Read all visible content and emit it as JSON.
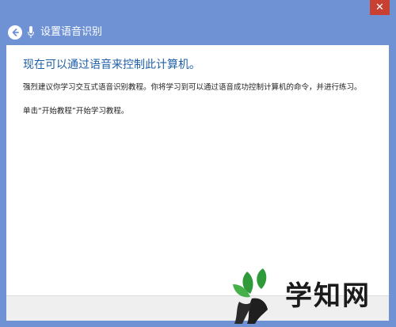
{
  "header": {
    "title": "设置语音识别"
  },
  "content": {
    "heading": "现在可以通过语音来控制此计算机。",
    "paragraph1": "强烈建议你学习交互式语音识别教程。你将学习到可以通过语音成功控制计算机的命令，并进行练习。",
    "paragraph2": "单击“开始教程”开始学习教程。"
  },
  "watermark": {
    "text": "学知网"
  },
  "colors": {
    "window_frame": "#6f92d4",
    "heading_blue": "#1f5fa9",
    "close_red": "#c84031",
    "logo_green": "#2f9a3a"
  }
}
